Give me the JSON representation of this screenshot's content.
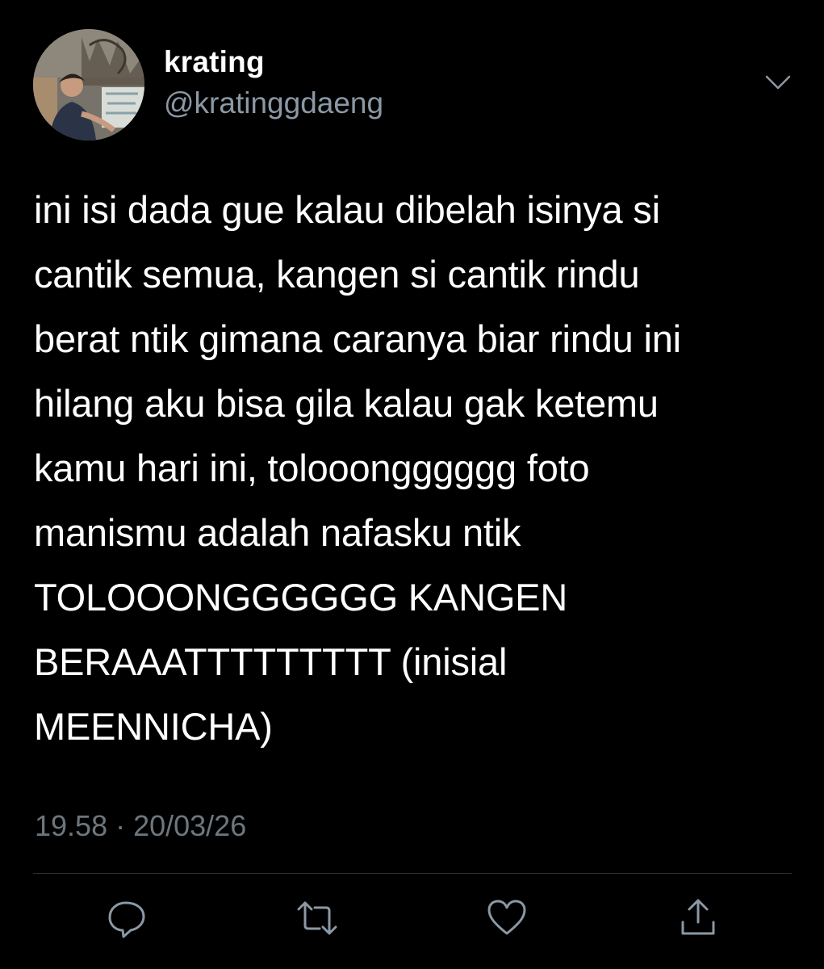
{
  "tweet": {
    "display_name": "krating",
    "handle": "@kratinggdaeng",
    "text": "ini isi dada gue kalau dibelah isinya si\ncantik semua, kangen si cantik rindu\nberat ntik gimana caranya biar rindu ini\nhilang aku bisa gila kalau gak ketemu\nkamu hari ini, tolooongggggg foto\nmanismu adalah nafasku ntik\nTOLOOONGGGGGG KANGEN\nBERAAATTTTTTTTT (inisial\nMEENNICHA)",
    "time": "19.58",
    "separator": "·",
    "date": "20/03/26"
  },
  "icons": {
    "more": "chevron-down-icon",
    "reply": "reply-icon",
    "retweet": "retweet-icon",
    "like": "heart-icon",
    "share": "share-icon"
  },
  "colors": {
    "background": "#000000",
    "text": "#ffffff",
    "secondary": "#8b98a5",
    "muted": "#6e767d",
    "icon": "#8b98a5",
    "divider": "#2f3336"
  }
}
